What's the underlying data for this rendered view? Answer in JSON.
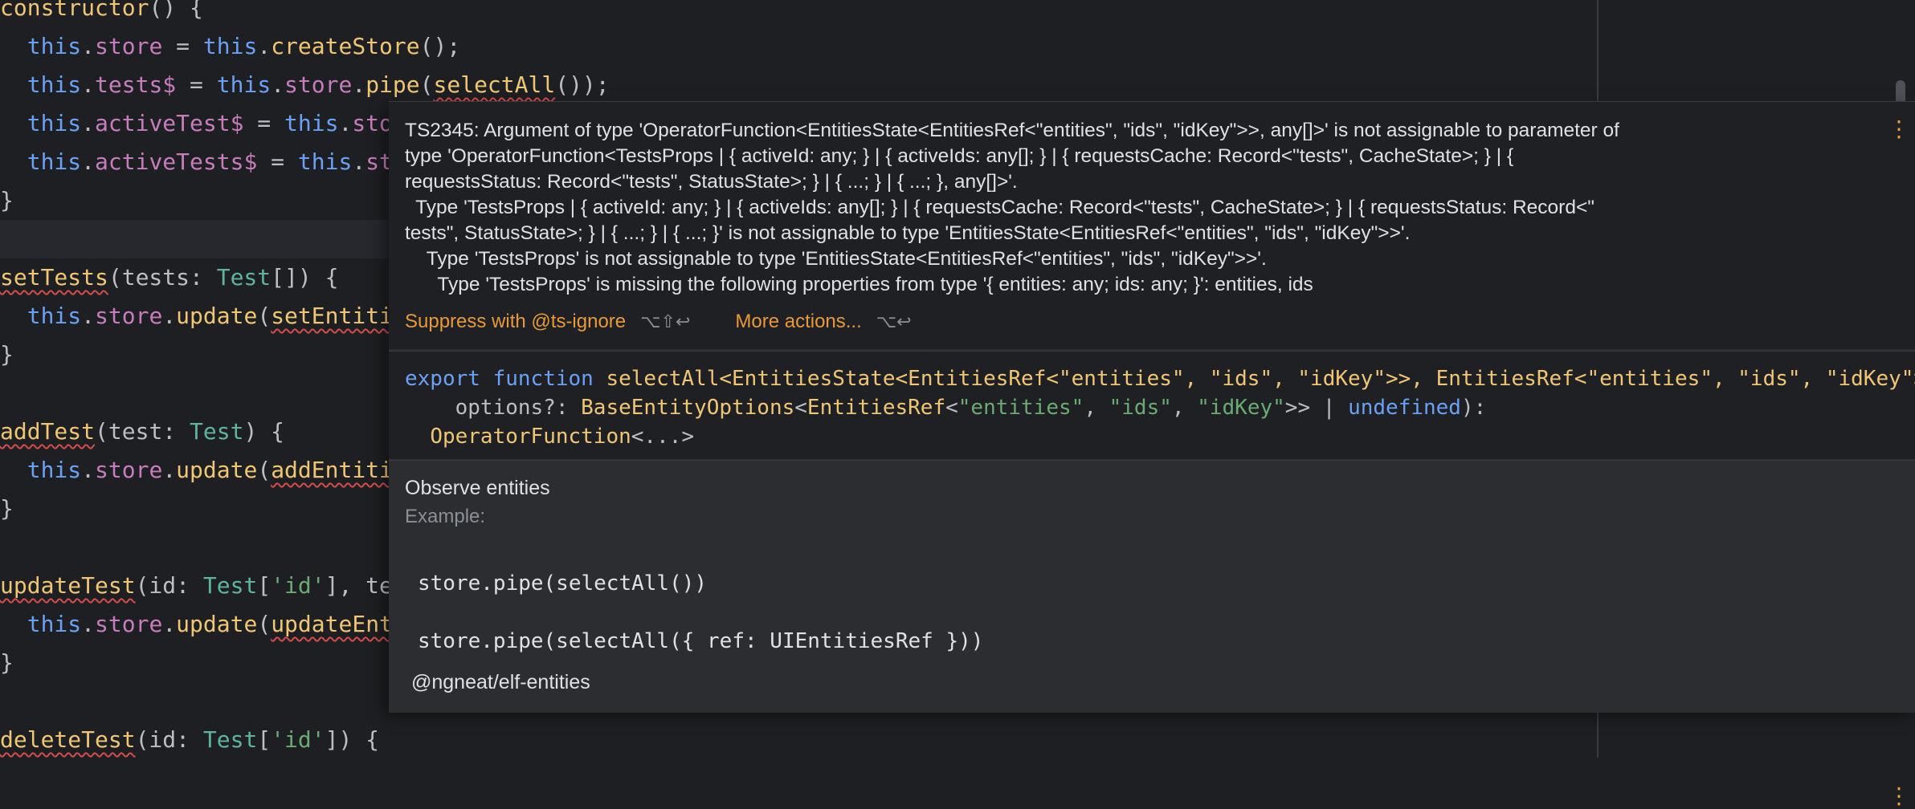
{
  "editor": {
    "lines": {
      "l1": {
        "kw": "constructor",
        "rest": "() {"
      },
      "l2": {
        "t1": "this",
        "t2": ".",
        "p1": "store",
        "t3": " = ",
        "t4": "this",
        "t5": ".",
        "f1": "createStore",
        "t6": "();"
      },
      "l3": {
        "t1": "this",
        "t2": ".",
        "p1": "tests$",
        "t3": " = ",
        "t4": "this",
        "t5": ".",
        "p2": "store",
        "t6": ".",
        "f1": "pipe",
        "t7": "(",
        "f2": "selectAll",
        "t8": "());"
      },
      "l4": {
        "t1": "this",
        "t2": ".",
        "p1": "activeTest$",
        "t3": " = ",
        "t4": "this",
        "t5": ".",
        "p2": "sto"
      },
      "l5": {
        "t1": "this",
        "t2": ".",
        "p1": "activeTests$",
        "t3": " = ",
        "t4": "this",
        "t5": ".",
        "p2": "st"
      },
      "l6": {
        "t1": "}"
      },
      "l7": {
        "f1": "setTests",
        "t1": "(tests: ",
        "ty": "Test",
        "t2": "[]) {"
      },
      "l8": {
        "t1": "this",
        "t2": ".",
        "p1": "store",
        "t3": ".",
        "f1": "update",
        "t4": "(",
        "f2": "setEntiti"
      },
      "l9": {
        "t1": "}"
      },
      "l10": {
        "f1": "addTest",
        "t1": "(test: ",
        "ty": "Test",
        "t2": ") {"
      },
      "l11": {
        "t1": "this",
        "t2": ".",
        "p1": "store",
        "t3": ".",
        "f1": "update",
        "t4": "(",
        "f2": "addEntiti"
      },
      "l12": {
        "t1": "}"
      },
      "l13": {
        "f1": "updateTest",
        "t1": "(id: ",
        "ty": "Test",
        "t2": "[",
        "s1": "'id'",
        "t3": "], te"
      },
      "l14": {
        "t1": "this",
        "t2": ".",
        "p1": "store",
        "t3": ".",
        "f1": "update",
        "t4": "(",
        "f2": "updateEnt"
      },
      "l15": {
        "t1": "}"
      },
      "l16": {
        "f1": "deleteTest",
        "t1": "(id: ",
        "ty": "Test",
        "t2": "[",
        "s1": "'id'",
        "t3": "]) {"
      }
    }
  },
  "popup": {
    "error_lines": [
      "TS2345: Argument of type 'OperatorFunction<EntitiesState<EntitiesRef<\"entities\", \"ids\", \"idKey\">>, any[]>' is not assignable to parameter of",
      "type 'OperatorFunction<TestsProps | { activeId: any; } | { activeIds: any[]; } | { requestsCache: Record<\"tests\", CacheState>; } | {",
      "requestsStatus: Record<\"tests\", StatusState>; } | { ...; } | { ...; }, any[]>'.",
      "  Type 'TestsProps | { activeId: any; } | { activeIds: any[]; } | { requestsCache: Record<\"tests\", CacheState>; } | { requestsStatus: Record<\"",
      "tests\", StatusState>; } | { ...; } | { ...; }' is not assignable to type 'EntitiesState<EntitiesRef<\"entities\", \"ids\", \"idKey\">>'.",
      "    Type 'TestsProps' is not assignable to type 'EntitiesState<EntitiesRef<\"entities\", \"ids\", \"idKey\">>'.",
      "      Type 'TestsProps' is missing the following properties from type '{ entities: any; ids: any; }': entities, ids"
    ],
    "actions": {
      "suppress_label": "Suppress with @ts-ignore",
      "suppress_shortcut": "⌥⇧↩",
      "more_label": "More actions...",
      "more_shortcut": "⌥↩"
    },
    "kebab_icon": "⋮",
    "signature": {
      "l1": {
        "kw1": "export",
        "kw2": "function",
        "fn": "selectAll",
        "rest": "<EntitiesState<EntitiesRef<\"entities\", \"ids\", \"idKey\">>, EntitiesRef<\"entities\", \"ids\", \"idKey\">>("
      },
      "l2": {
        "indent": "    options?: ",
        "ty1": "BaseEntityOptions",
        "lt": "<",
        "ty2": "EntitiesRef",
        "lt2": "<",
        "s1": "\"entities\"",
        "c1": ", ",
        "s2": "\"ids\"",
        "c2": ", ",
        "s3": "\"idKey\"",
        "gt": ">> | ",
        "kw": "undefined",
        "end": "):"
      },
      "l3": {
        "indent": "  ",
        "ty": "OperatorFunction",
        "rest": "<...>"
      }
    },
    "doc": {
      "description": "Observe entities",
      "example_label": "Example:",
      "code1": "store.pipe(selectAll())",
      "code2": "store.pipe(selectAll({ ref: UIEntitiesRef }))",
      "package": "@ngneat/elf-entities"
    }
  }
}
